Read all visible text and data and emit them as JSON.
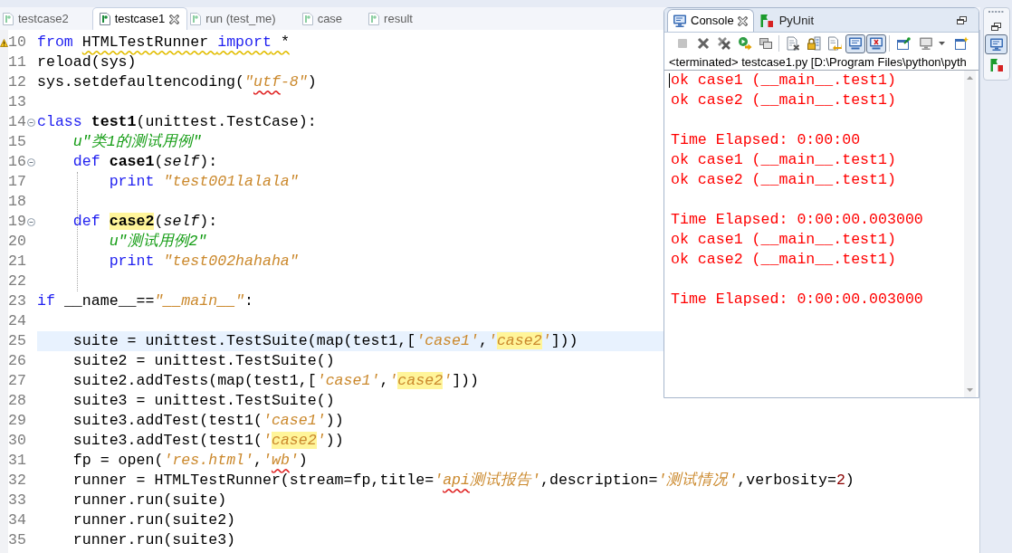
{
  "editor": {
    "tabs": [
      {
        "label": "testcase2",
        "selected": false
      },
      {
        "label": "testcase1",
        "selected": true
      },
      {
        "label": "run (test_me)",
        "selected": false
      },
      {
        "label": "case",
        "selected": false
      },
      {
        "label": "result",
        "selected": false
      }
    ],
    "lines": [
      {
        "number": "10",
        "warning": true,
        "foldable": false,
        "current": false,
        "tokens": [
          {
            "kind": "keyword",
            "text": "from "
          },
          {
            "kind": "plain",
            "text": "HTMLTestRunner ",
            "warning": true
          },
          {
            "kind": "keyword",
            "text": "import",
            "warning": true
          },
          {
            "kind": "plain",
            "text": " *",
            "warning": true
          }
        ]
      },
      {
        "number": "11",
        "warning": false,
        "foldable": false,
        "current": false,
        "tokens": [
          {
            "kind": "plain",
            "text": "reload(sys)"
          }
        ]
      },
      {
        "number": "12",
        "warning": false,
        "foldable": false,
        "current": false,
        "tokens": [
          {
            "kind": "plain",
            "text": "sys.setdefaultencoding("
          },
          {
            "kind": "string",
            "text": "\""
          },
          {
            "kind": "string",
            "text": "utf",
            "error": true
          },
          {
            "kind": "string",
            "text": "-8\""
          },
          {
            "kind": "plain",
            "text": ")"
          }
        ]
      },
      {
        "number": "13",
        "warning": false,
        "foldable": false,
        "current": false
      },
      {
        "number": "14",
        "warning": false,
        "foldable": true,
        "current": false,
        "tokens": [
          {
            "kind": "keyword",
            "text": "class "
          },
          {
            "kind": "defname",
            "text": "test1"
          },
          {
            "kind": "plain",
            "text": "(unittest.TestCase):"
          }
        ]
      },
      {
        "number": "15",
        "warning": false,
        "foldable": false,
        "current": false,
        "tokens": [
          {
            "kind": "docstring",
            "text": "    u\"类1的测试用例\""
          }
        ]
      },
      {
        "number": "16",
        "warning": false,
        "foldable": true,
        "current": false,
        "tokens": [
          {
            "kind": "keyword",
            "text": "    def "
          },
          {
            "kind": "defname",
            "text": "case1"
          },
          {
            "kind": "plain",
            "text": "("
          },
          {
            "kind": "self",
            "text": "self"
          },
          {
            "kind": "plain",
            "text": "):"
          }
        ]
      },
      {
        "number": "17",
        "warning": false,
        "foldable": false,
        "current": false,
        "tokens": [
          {
            "kind": "keyword",
            "text": "        print "
          },
          {
            "kind": "string",
            "text": "\"test001lalala\""
          }
        ]
      },
      {
        "number": "18",
        "warning": false,
        "foldable": false,
        "current": false
      },
      {
        "number": "19",
        "warning": false,
        "foldable": true,
        "current": false,
        "tokens": [
          {
            "kind": "keyword",
            "text": "    def "
          },
          {
            "kind": "defname",
            "text": "case2",
            "highlighted": true
          },
          {
            "kind": "plain",
            "text": "("
          },
          {
            "kind": "self",
            "text": "self"
          },
          {
            "kind": "plain",
            "text": "):"
          }
        ]
      },
      {
        "number": "20",
        "warning": false,
        "foldable": false,
        "current": false,
        "tokens": [
          {
            "kind": "docstring",
            "text": "        u\"测试用例2\""
          }
        ]
      },
      {
        "number": "21",
        "warning": false,
        "foldable": false,
        "current": false,
        "tokens": [
          {
            "kind": "keyword",
            "text": "        print "
          },
          {
            "kind": "string",
            "text": "\"test002hahaha\""
          }
        ]
      },
      {
        "number": "22",
        "warning": false,
        "foldable": false,
        "current": false
      },
      {
        "number": "23",
        "warning": false,
        "foldable": false,
        "current": false,
        "tokens": [
          {
            "kind": "keyword",
            "text": "if"
          },
          {
            "kind": "plain",
            "text": " __name__=="
          },
          {
            "kind": "string",
            "text": "\"__main__\""
          },
          {
            "kind": "plain",
            "text": ":"
          }
        ]
      },
      {
        "number": "24",
        "warning": false,
        "foldable": false,
        "current": false
      },
      {
        "number": "25",
        "warning": false,
        "foldable": false,
        "current": true,
        "tokens": [
          {
            "kind": "plain",
            "text": "    suite = unittest.TestSuite(map(test1,["
          },
          {
            "kind": "string",
            "text": "'case1'"
          },
          {
            "kind": "plain",
            "text": ","
          },
          {
            "kind": "string",
            "text": "'"
          },
          {
            "kind": "string",
            "text": "case2",
            "highlighted": true
          },
          {
            "kind": "string",
            "text": "'"
          },
          {
            "kind": "plain",
            "text": "]))"
          }
        ]
      },
      {
        "number": "26",
        "warning": false,
        "foldable": false,
        "current": false,
        "tokens": [
          {
            "kind": "plain",
            "text": "    suite2 = unittest.TestSuite()"
          }
        ]
      },
      {
        "number": "27",
        "warning": false,
        "foldable": false,
        "current": false,
        "tokens": [
          {
            "kind": "plain",
            "text": "    suite2.addTests(map(test1,["
          },
          {
            "kind": "string",
            "text": "'case1'"
          },
          {
            "kind": "plain",
            "text": ","
          },
          {
            "kind": "string",
            "text": "'"
          },
          {
            "kind": "string",
            "text": "case2",
            "highlighted": true
          },
          {
            "kind": "string",
            "text": "'"
          },
          {
            "kind": "plain",
            "text": "]))"
          }
        ]
      },
      {
        "number": "28",
        "warning": false,
        "foldable": false,
        "current": false,
        "tokens": [
          {
            "kind": "plain",
            "text": "    suite3 = unittest.TestSuite()"
          }
        ]
      },
      {
        "number": "29",
        "warning": false,
        "foldable": false,
        "current": false,
        "tokens": [
          {
            "kind": "plain",
            "text": "    suite3.addTest(test1("
          },
          {
            "kind": "string",
            "text": "'case1'"
          },
          {
            "kind": "plain",
            "text": "))"
          }
        ]
      },
      {
        "number": "30",
        "warning": false,
        "foldable": false,
        "current": false,
        "tokens": [
          {
            "kind": "plain",
            "text": "    suite3.addTest(test1("
          },
          {
            "kind": "string",
            "text": "'"
          },
          {
            "kind": "string",
            "text": "case2",
            "highlighted": true
          },
          {
            "kind": "string",
            "text": "'"
          },
          {
            "kind": "plain",
            "text": "))"
          }
        ]
      },
      {
        "number": "31",
        "warning": false,
        "foldable": false,
        "current": false,
        "tokens": [
          {
            "kind": "plain",
            "text": "    fp = open("
          },
          {
            "kind": "string",
            "text": "'res.html'"
          },
          {
            "kind": "plain",
            "text": ","
          },
          {
            "kind": "string",
            "text": "'"
          },
          {
            "kind": "string",
            "text": "wb",
            "error": true
          },
          {
            "kind": "string",
            "text": "'"
          },
          {
            "kind": "plain",
            "text": ")"
          }
        ]
      },
      {
        "number": "32",
        "warning": false,
        "foldable": false,
        "current": false,
        "tokens": [
          {
            "kind": "plain",
            "text": "    runner = HTMLTestRunner(stream=fp,title="
          },
          {
            "kind": "string",
            "text": "'"
          },
          {
            "kind": "string",
            "text": "api",
            "error": true
          },
          {
            "kind": "string",
            "text": "测试报告'"
          },
          {
            "kind": "plain",
            "text": ",description="
          },
          {
            "kind": "string",
            "text": "'测试情况'"
          },
          {
            "kind": "plain",
            "text": ",verbosity="
          },
          {
            "kind": "number",
            "text": "2"
          },
          {
            "kind": "plain",
            "text": ")"
          }
        ]
      },
      {
        "number": "33",
        "warning": false,
        "foldable": false,
        "current": false,
        "tokens": [
          {
            "kind": "plain",
            "text": "    runner.run(suite)"
          }
        ]
      },
      {
        "number": "34",
        "warning": false,
        "foldable": false,
        "current": false,
        "tokens": [
          {
            "kind": "plain",
            "text": "    runner.run(suite2)"
          }
        ]
      },
      {
        "number": "35",
        "warning": false,
        "foldable": false,
        "current": false,
        "tokens": [
          {
            "kind": "plain",
            "text": "    runner.run(suite3)"
          }
        ]
      }
    ]
  },
  "console": {
    "tabs": [
      {
        "label": "Console",
        "kind": "console",
        "selected": true
      },
      {
        "label": "PyUnit",
        "kind": "test-results",
        "selected": false
      }
    ],
    "toolbar": [
      {
        "disabled": true,
        "pressed": false
      },
      {
        "disabled": false,
        "pressed": false
      },
      {
        "disabled": false,
        "pressed": false
      },
      {
        "disabled": false,
        "pressed": false
      },
      {
        "disabled": false,
        "pressed": false
      },
      {
        "disabled": false,
        "pressed": false
      },
      {
        "disabled": false,
        "pressed": false
      },
      {
        "disabled": false,
        "pressed": false
      },
      {
        "disabled": false,
        "pressed": true
      },
      {
        "disabled": false,
        "pressed": true
      },
      {
        "disabled": false,
        "pressed": false
      },
      {
        "disabled": false,
        "pressed": false
      },
      {
        "disabled": false,
        "pressed": false
      }
    ],
    "status": "<terminated> testcase1.py [D:\\Program Files\\python\\pyth",
    "output": [
      {
        "kind": "stderr",
        "text": "ok case1 (__main__.test1)"
      },
      {
        "kind": "stderr",
        "text": "ok case2 (__main__.test1)"
      },
      {
        "kind": "blank"
      },
      {
        "kind": "stderr",
        "text": "Time Elapsed: 0:00:00"
      },
      {
        "kind": "stderr",
        "text": "ok case1 (__main__.test1)"
      },
      {
        "kind": "stderr",
        "text": "ok case2 (__main__.test1)"
      },
      {
        "kind": "blank"
      },
      {
        "kind": "stderr",
        "text": "Time Elapsed: 0:00:00.003000"
      },
      {
        "kind": "stderr",
        "text": "ok case1 (__main__.test1)"
      },
      {
        "kind": "stderr",
        "text": "ok case2 (__main__.test1)"
      },
      {
        "kind": "blank"
      },
      {
        "kind": "stderr",
        "text": "Time Elapsed: 0:00:00.003000"
      }
    ]
  },
  "side_trim": {
    "views": [
      {
        "kind": "console",
        "selected": true
      },
      {
        "kind": "test-results",
        "selected": false
      }
    ]
  }
}
